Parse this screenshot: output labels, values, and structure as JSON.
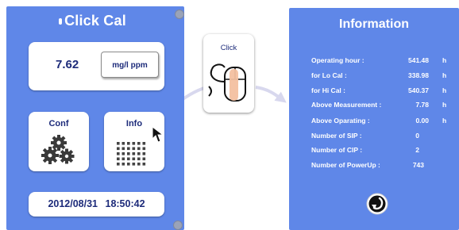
{
  "left_panel": {
    "title": "Click Cal",
    "measurement": {
      "value": "7.62",
      "unit_button": "mg/l ppm"
    },
    "buttons": {
      "conf": "Conf",
      "info": "Info"
    },
    "datetime": "2012/08/31   18:50:42"
  },
  "click_card": {
    "label": "Click"
  },
  "info_panel": {
    "title": "Information",
    "rows": [
      {
        "label": "Operating hour :",
        "value": "541.48",
        "unit": "h"
      },
      {
        "label": "for Lo Cal :",
        "value": "338.98",
        "unit": "h"
      },
      {
        "label": "for Hi Cal :",
        "value": "540.37",
        "unit": "h"
      },
      {
        "label": "Above Measurement :",
        "value": "7.78",
        "unit": "h"
      },
      {
        "label": "Above Oparating :",
        "value": "0.00",
        "unit": "h"
      },
      {
        "label": "Number of SIP :",
        "value": "0",
        "unit": ""
      },
      {
        "label": "Number of CIP :",
        "value": "2",
        "unit": ""
      },
      {
        "label": "Number of PowerUp :",
        "value": "743",
        "unit": ""
      }
    ]
  },
  "colors": {
    "panel": "#5f87e8",
    "text_dark": "#1d2b7a",
    "arrow": "#d8d8ee"
  },
  "icons": [
    "gears-icon",
    "dot-grid-icon",
    "mouse-pointer-icon",
    "mouse-click-icon",
    "back-arrow-icon",
    "close-icon"
  ]
}
